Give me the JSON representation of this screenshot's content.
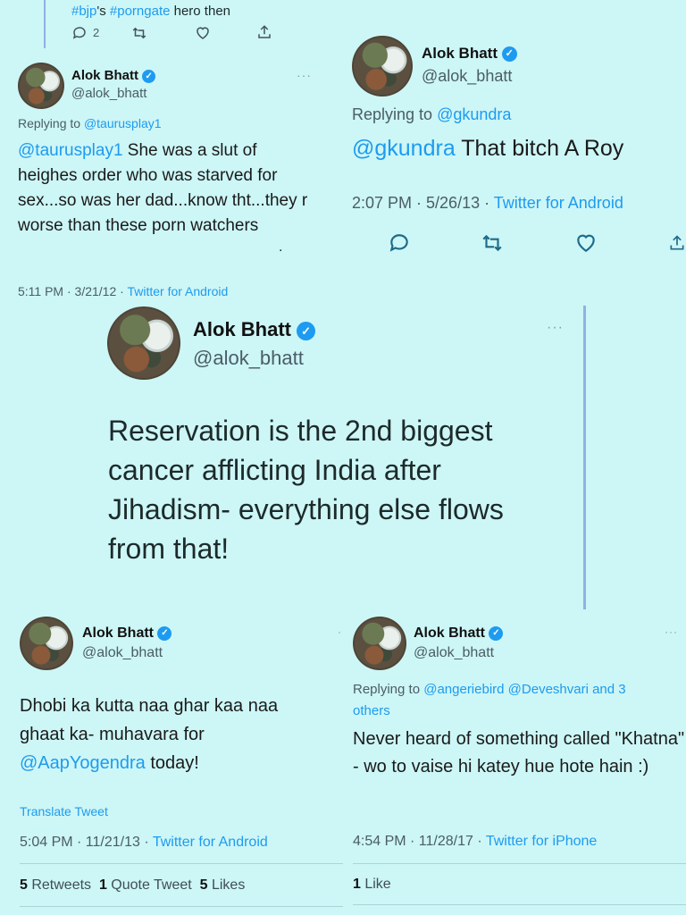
{
  "top": {
    "text_hashtag1": "#bjp",
    "text_mid": "'s ",
    "text_hashtag2": "#porngate",
    "text_tail": " hero then",
    "reply_count": "2"
  },
  "tweet1": {
    "name": "Alok Bhatt",
    "handle": "@alok_bhatt",
    "replying_label": "Replying to ",
    "replying_to": "@taurusplay1",
    "mention": "@taurusplay1",
    "body": " She was a slut of heighes order who was starved for sex...so was her dad...know tht...they r worse than these porn watchers",
    "dot": ".",
    "time": "5:11 PM · 3/21/12 · ",
    "source": "Twitter for Android"
  },
  "tweet2": {
    "name": "Alok Bhatt",
    "handle": "@alok_bhatt",
    "replying_label": "Replying to ",
    "replying_to": "@gkundra",
    "mention": "@gkundra",
    "body": " That bitch A Roy",
    "time": "2:07 PM · 5/26/13 · ",
    "source": "Twitter for Android"
  },
  "tweet3": {
    "name": "Alok Bhatt",
    "handle": "@alok_bhatt",
    "body": "Reservation is the 2nd biggest cancer afflicting India after Jihadism- everything else flows from that!"
  },
  "tweet4": {
    "name": "Alok Bhatt",
    "handle": "@alok_bhatt",
    "body": "Dhobi ka kutta naa ghar kaa naa ghaat ka- muhavara for ",
    "mention": "@AapYogendra",
    "body_tail": " today!",
    "translate": "Translate Tweet",
    "time": "5:04 PM · 11/21/13 · ",
    "source": "Twitter for Android",
    "retweets_num": "5",
    "retweets_label": " Retweets",
    "quotes_num": "1",
    "quotes_label": " Quote Tweet",
    "likes_num": "5",
    "likes_label": " Likes"
  },
  "tweet5": {
    "name": "Alok Bhatt",
    "handle": "@alok_bhatt",
    "replying_label": "Replying to ",
    "replying_to": "@angeriebird @Deveshvari and 3 others",
    "body": "Never heard of something called \"Khatna\" - wo to vaise hi katey hue hote hain :)",
    "time": "4:54 PM · 11/28/17 · ",
    "source": "Twitter for iPhone",
    "likes_num": "1",
    "likes_label": " Like"
  },
  "icons": [
    "reply-icon",
    "retweet-icon",
    "like-icon",
    "share-icon",
    "verified-badge-icon",
    "more-dots-icon"
  ],
  "colors": {
    "background": "#cdf6f6",
    "link": "#1d9bf0",
    "verified": "#1d9bf0",
    "thread_line": "#8fb1e6"
  }
}
